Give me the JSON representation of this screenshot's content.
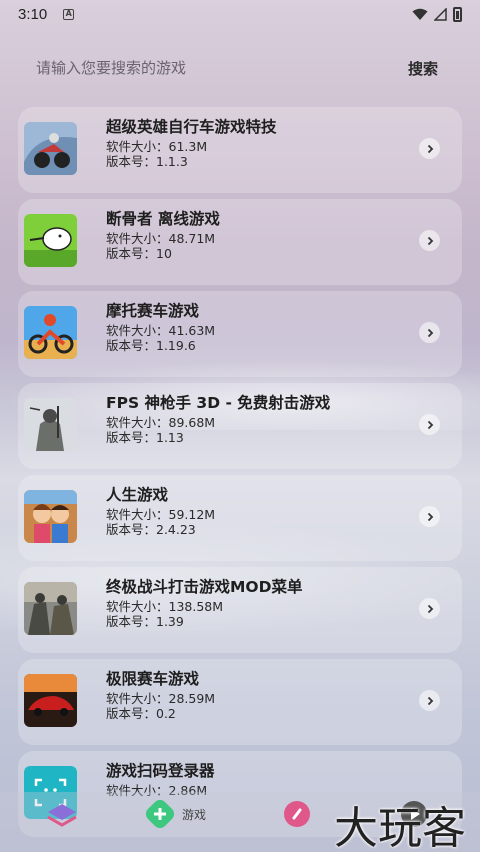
{
  "status": {
    "time": "3:10",
    "notif": "A"
  },
  "search": {
    "placeholder": "请输入您要搜索的游戏",
    "button": "搜索"
  },
  "games": [
    {
      "title": "超级英雄自行车游戏特技",
      "size": "软件大小：61.3M",
      "version": "版本号：1.1.3"
    },
    {
      "title": "断骨者 离线游戏",
      "size": "软件大小：48.71M",
      "version": "版本号：10"
    },
    {
      "title": "摩托赛车游戏",
      "size": "软件大小：41.63M",
      "version": "版本号：1.19.6"
    },
    {
      "title": "FPS 神枪手 3D - 免费射击游戏",
      "size": "软件大小：89.68M",
      "version": "版本号：1.13"
    },
    {
      "title": "人生游戏",
      "size": "软件大小：59.12M",
      "version": "版本号：2.4.23"
    },
    {
      "title": "终极战斗打击游戏MOD菜单",
      "size": "软件大小：138.58M",
      "version": "版本号：1.39"
    },
    {
      "title": "极限赛车游戏",
      "size": "软件大小：28.59M",
      "version": "版本号：0.2"
    },
    {
      "title": "游戏扫码登录器",
      "size": "软件大小：2.86M",
      "version": ""
    }
  ],
  "nav": {
    "games_label": "游戏"
  },
  "watermark": "大玩客",
  "colors": {
    "accent_green": "#3ec77f",
    "accent_pink": "#e0578a",
    "accent_purple": "#8a6fd8"
  }
}
